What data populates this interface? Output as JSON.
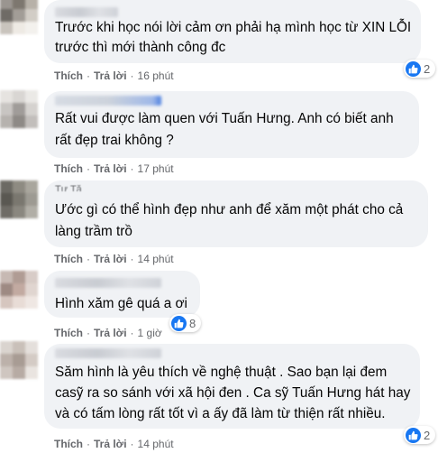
{
  "comments": [
    {
      "lines": [
        "Trước khi học nói lời cảm ơn phải hạ mình học từ XIN LỖI",
        "trước thì mới thành công đc"
      ],
      "like_label": "Thích",
      "reply_label": "Trả lời",
      "time": "16 phút",
      "reaction_count": "2"
    },
    {
      "lines": [
        "Rất vui được làm quen với Tuấn Hưng. Anh có biết anh",
        "rất đẹp trai không ?"
      ],
      "like_label": "Thích",
      "reply_label": "Trả lời",
      "time": "17 phút"
    },
    {
      "lines": [
        "Ước gì có thể hình đẹp như anh để xăm một phát cho cả",
        "làng trầm trồ"
      ],
      "like_label": "Thích",
      "reply_label": "Trả lời",
      "time": "14 phút"
    },
    {
      "lines": [
        "Hình xăm gê quá a ơi"
      ],
      "like_label": "Thích",
      "reply_label": "Trả lời",
      "time": "1 giờ",
      "reaction_count": "8"
    },
    {
      "lines": [
        "Săm hình là yêu thích về nghệ thuật . Sao bạn lại đem",
        "casỹ ra so sánh với xã hội đen . Ca sỹ Tuấn Hưng hát hay",
        "và có tấm lòng rất tốt vì a ấy đã làm từ thiện rất nhiều."
      ],
      "like_label": "Thích",
      "reply_label": "Trả lời",
      "time": "14 phút",
      "reaction_count": "2"
    }
  ],
  "colors": {
    "bubble": "#f0f2f5",
    "like_blue": "#1877f2",
    "meta_gray": "#65676b",
    "text": "#050505"
  },
  "icons": {
    "reaction": "like-thumb-icon"
  }
}
